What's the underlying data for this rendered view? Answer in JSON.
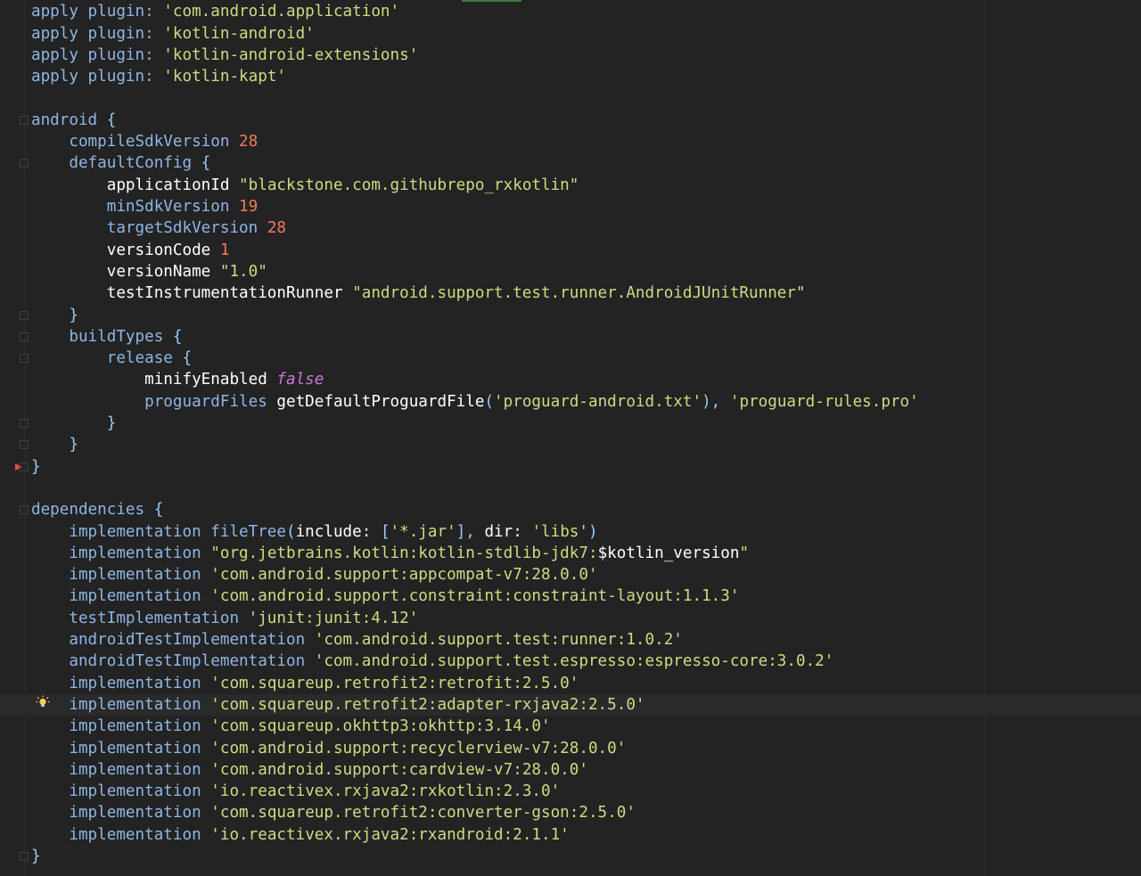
{
  "editor": {
    "language": "gradle",
    "current_line": 32,
    "colors": {
      "background": "#232323",
      "keyword": "#8fb6e4",
      "string": "#cddc82",
      "number": "#f27b5e",
      "boolean": "#c97ad6",
      "plain": "#ffffff"
    },
    "lines": [
      [
        {
          "k": "kw",
          "t": "apply plugin: "
        },
        {
          "k": "str",
          "t": "'com.android.application'"
        }
      ],
      [
        {
          "k": "kw",
          "t": "apply plugin: "
        },
        {
          "k": "str",
          "t": "'kotlin-android'"
        }
      ],
      [
        {
          "k": "kw",
          "t": "apply plugin: "
        },
        {
          "k": "str",
          "t": "'kotlin-android-extensions'"
        }
      ],
      [
        {
          "k": "kw",
          "t": "apply plugin: "
        },
        {
          "k": "str",
          "t": "'kotlin-kapt'"
        }
      ],
      [],
      [
        {
          "k": "kw",
          "t": "android "
        },
        {
          "k": "punct",
          "t": "{"
        }
      ],
      [
        {
          "k": "kw",
          "t": "    compileSdkVersion "
        },
        {
          "k": "num",
          "t": "28"
        }
      ],
      [
        {
          "k": "kw",
          "t": "    defaultConfig "
        },
        {
          "k": "punct",
          "t": "{"
        }
      ],
      [
        {
          "k": "plain",
          "t": "        applicationId "
        },
        {
          "k": "str",
          "t": "\"blackstone.com.githubrepo_rxkotlin\""
        }
      ],
      [
        {
          "k": "kw",
          "t": "        minSdkVersion "
        },
        {
          "k": "num",
          "t": "19"
        }
      ],
      [
        {
          "k": "kw",
          "t": "        targetSdkVersion "
        },
        {
          "k": "num",
          "t": "28"
        }
      ],
      [
        {
          "k": "plain",
          "t": "        versionCode "
        },
        {
          "k": "num",
          "t": "1"
        }
      ],
      [
        {
          "k": "plain",
          "t": "        versionName "
        },
        {
          "k": "str",
          "t": "\"1.0\""
        }
      ],
      [
        {
          "k": "plain",
          "t": "        testInstrumentationRunner "
        },
        {
          "k": "str",
          "t": "\"android.support.test.runner.AndroidJUnitRunner\""
        }
      ],
      [
        {
          "k": "punct",
          "t": "    }"
        }
      ],
      [
        {
          "k": "kw",
          "t": "    buildTypes "
        },
        {
          "k": "punct",
          "t": "{"
        }
      ],
      [
        {
          "k": "kw",
          "t": "        release "
        },
        {
          "k": "punct",
          "t": "{"
        }
      ],
      [
        {
          "k": "plain",
          "t": "            minifyEnabled "
        },
        {
          "k": "bool",
          "t": "false"
        }
      ],
      [
        {
          "k": "kw",
          "t": "            proguardFiles "
        },
        {
          "k": "plain",
          "t": "getDefaultProguardFile"
        },
        {
          "k": "punct",
          "t": "("
        },
        {
          "k": "str",
          "t": "'proguard-android.txt'"
        },
        {
          "k": "punct",
          "t": "), "
        },
        {
          "k": "str",
          "t": "'proguard-rules.pro'"
        }
      ],
      [
        {
          "k": "punct",
          "t": "        }"
        }
      ],
      [
        {
          "k": "punct",
          "t": "    }"
        }
      ],
      [
        {
          "k": "punct",
          "t": "}"
        }
      ],
      [],
      [
        {
          "k": "kw",
          "t": "dependencies "
        },
        {
          "k": "punct",
          "t": "{"
        }
      ],
      [
        {
          "k": "kw",
          "t": "    implementation fileTree"
        },
        {
          "k": "punct",
          "t": "("
        },
        {
          "k": "plain",
          "t": "include: "
        },
        {
          "k": "punct",
          "t": "["
        },
        {
          "k": "str",
          "t": "'*.jar'"
        },
        {
          "k": "punct",
          "t": "], "
        },
        {
          "k": "plain",
          "t": "dir: "
        },
        {
          "k": "str",
          "t": "'libs'"
        },
        {
          "k": "punct",
          "t": ")"
        }
      ],
      [
        {
          "k": "kw",
          "t": "    implementation "
        },
        {
          "k": "str",
          "t": "\"org.jetbrains.kotlin:kotlin-stdlib-jdk7:"
        },
        {
          "k": "plain",
          "t": "$kotlin_version"
        },
        {
          "k": "str",
          "t": "\""
        }
      ],
      [
        {
          "k": "kw",
          "t": "    implementation "
        },
        {
          "k": "str",
          "t": "'com.android.support:appcompat-v7:28.0.0'"
        }
      ],
      [
        {
          "k": "kw",
          "t": "    implementation "
        },
        {
          "k": "str",
          "t": "'com.android.support.constraint:constraint-layout:1.1.3'"
        }
      ],
      [
        {
          "k": "kw",
          "t": "    testImplementation "
        },
        {
          "k": "str",
          "t": "'junit:junit:4.12'"
        }
      ],
      [
        {
          "k": "kw",
          "t": "    androidTestImplementation "
        },
        {
          "k": "str",
          "t": "'com.android.support.test:runner:1.0.2'"
        }
      ],
      [
        {
          "k": "kw",
          "t": "    androidTestImplementation "
        },
        {
          "k": "str",
          "t": "'com.android.support.test.espresso:espresso-core:3.0.2'"
        }
      ],
      [
        {
          "k": "kw",
          "t": "    implementation "
        },
        {
          "k": "str",
          "t": "'com.squareup.retrofit2:retrofit:2.5.0'"
        }
      ],
      [
        {
          "k": "kw",
          "t": "    implementation "
        },
        {
          "k": "str",
          "t": "'com.squareup.retrofit2:adapter-rxjava2:2.5.0'"
        }
      ],
      [
        {
          "k": "kw",
          "t": "    implementation "
        },
        {
          "k": "str",
          "t": "'com.squareup.okhttp3:okhttp:3.14.0'"
        }
      ],
      [
        {
          "k": "kw",
          "t": "    implementation "
        },
        {
          "k": "str",
          "t": "'com.android.support:recyclerview-v7:28.0.0'"
        }
      ],
      [
        {
          "k": "kw",
          "t": "    implementation "
        },
        {
          "k": "str",
          "t": "'com.android.support:cardview-v7:28.0.0'"
        }
      ],
      [
        {
          "k": "kw",
          "t": "    implementation "
        },
        {
          "k": "str",
          "t": "'io.reactivex.rxjava2:rxkotlin:2.3.0'"
        }
      ],
      [
        {
          "k": "kw",
          "t": "    implementation "
        },
        {
          "k": "str",
          "t": "'com.squareup.retrofit2:converter-gson:2.5.0'"
        }
      ],
      [
        {
          "k": "kw",
          "t": "    implementation "
        },
        {
          "k": "str",
          "t": "'io.reactivex.rxjava2:rxandroid:2.1.1'"
        }
      ],
      [
        {
          "k": "punct",
          "t": "}"
        }
      ]
    ],
    "fold_lines": [
      5,
      7,
      14,
      15,
      16,
      19,
      20,
      21,
      23,
      39
    ],
    "breakpoint_line": 21,
    "icons": [
      "fold-marker-icon",
      "breakpoint-arrow-icon",
      "lightbulb-icon"
    ]
  }
}
